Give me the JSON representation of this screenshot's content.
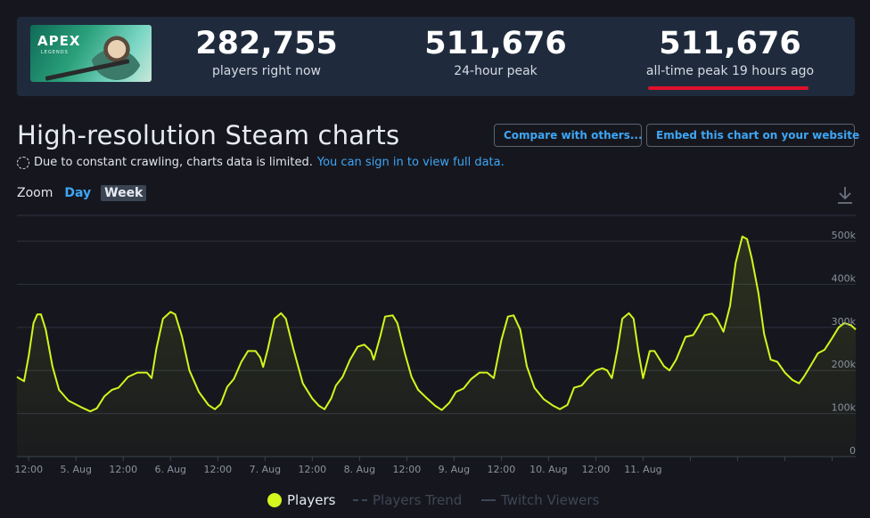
{
  "game": {
    "logo_text": "APEX",
    "logo_sub": "LEGENDS"
  },
  "stats": [
    {
      "value": "282,755",
      "label": "players right now"
    },
    {
      "value": "511,676",
      "label": "24-hour peak"
    },
    {
      "value": "511,676",
      "label": "all-time peak 19 hours ago"
    }
  ],
  "page_title": "High-resolution Steam charts",
  "notice": {
    "text": "Due to constant crawling, charts data is limited.",
    "link": "You can sign in to view full data."
  },
  "buttons": {
    "compare": "Compare with others...",
    "embed": "Embed this chart on your website"
  },
  "zoom": {
    "label": "Zoom",
    "day": "Day",
    "week": "Week"
  },
  "legend": {
    "players": "Players",
    "trend": "Players Trend",
    "twitch": "Twitch Viewers"
  },
  "colors": {
    "players_line": "#d4f51d",
    "accent": "#3ea6f5",
    "peak_marker": "#e0102a",
    "background": "#16171e"
  },
  "chart_data": {
    "type": "line",
    "series": [
      {
        "name": "Players",
        "points": [
          [
            -0.125,
            185
          ],
          [
            -0.05,
            175
          ],
          [
            0.0,
            235
          ],
          [
            0.05,
            310
          ],
          [
            0.09,
            330
          ],
          [
            0.13,
            330
          ],
          [
            0.18,
            295
          ],
          [
            0.25,
            210
          ],
          [
            0.32,
            155
          ],
          [
            0.42,
            130
          ],
          [
            0.55,
            115
          ],
          [
            0.65,
            105
          ],
          [
            0.72,
            112
          ],
          [
            0.8,
            140
          ],
          [
            0.88,
            155
          ],
          [
            0.95,
            160
          ],
          [
            1.05,
            185
          ],
          [
            1.15,
            195
          ],
          [
            1.25,
            195
          ],
          [
            1.3,
            182
          ],
          [
            1.35,
            250
          ],
          [
            1.42,
            320
          ],
          [
            1.5,
            336
          ],
          [
            1.55,
            330
          ],
          [
            1.62,
            280
          ],
          [
            1.7,
            200
          ],
          [
            1.8,
            150
          ],
          [
            1.9,
            120
          ],
          [
            1.97,
            110
          ],
          [
            2.03,
            122
          ],
          [
            2.1,
            162
          ],
          [
            2.17,
            180
          ],
          [
            2.25,
            220
          ],
          [
            2.32,
            245
          ],
          [
            2.4,
            245
          ],
          [
            2.45,
            230
          ],
          [
            2.48,
            208
          ],
          [
            2.53,
            250
          ],
          [
            2.6,
            320
          ],
          [
            2.67,
            333
          ],
          [
            2.72,
            320
          ],
          [
            2.8,
            250
          ],
          [
            2.9,
            170
          ],
          [
            3.0,
            135
          ],
          [
            3.07,
            118
          ],
          [
            3.13,
            110
          ],
          [
            3.2,
            135
          ],
          [
            3.25,
            165
          ],
          [
            3.32,
            185
          ],
          [
            3.4,
            225
          ],
          [
            3.48,
            255
          ],
          [
            3.55,
            260
          ],
          [
            3.62,
            245
          ],
          [
            3.65,
            225
          ],
          [
            3.72,
            280
          ],
          [
            3.77,
            325
          ],
          [
            3.85,
            328
          ],
          [
            3.9,
            310
          ],
          [
            3.98,
            240
          ],
          [
            4.05,
            185
          ],
          [
            4.12,
            155
          ],
          [
            4.2,
            138
          ],
          [
            4.3,
            118
          ],
          [
            4.37,
            108
          ],
          [
            4.45,
            125
          ],
          [
            4.52,
            150
          ],
          [
            4.6,
            158
          ],
          [
            4.68,
            180
          ],
          [
            4.77,
            195
          ],
          [
            4.85,
            195
          ],
          [
            4.92,
            182
          ],
          [
            5.0,
            270
          ],
          [
            5.07,
            325
          ],
          [
            5.13,
            328
          ],
          [
            5.2,
            295
          ],
          [
            5.27,
            210
          ],
          [
            5.35,
            160
          ],
          [
            5.45,
            133
          ],
          [
            5.55,
            118
          ],
          [
            5.62,
            110
          ],
          [
            5.7,
            120
          ],
          [
            5.77,
            160
          ],
          [
            5.85,
            165
          ],
          [
            5.92,
            183
          ],
          [
            6.0,
            200
          ],
          [
            6.07,
            205
          ],
          [
            6.12,
            200
          ],
          [
            6.17,
            182
          ],
          [
            6.23,
            250
          ],
          [
            6.28,
            320
          ],
          [
            6.35,
            333
          ],
          [
            6.4,
            320
          ],
          [
            6.45,
            245
          ],
          [
            6.5,
            182
          ],
          [
            6.57,
            245
          ],
          [
            6.62,
            245
          ],
          [
            6.72,
            210
          ],
          [
            6.78,
            200
          ],
          [
            6.85,
            225
          ],
          [
            6.95,
            278
          ],
          [
            7.03,
            282
          ],
          [
            7.08,
            300
          ],
          [
            7.15,
            328
          ],
          [
            7.23,
            332
          ],
          [
            7.28,
            320
          ],
          [
            7.35,
            290
          ],
          [
            7.42,
            350
          ],
          [
            7.48,
            450
          ],
          [
            7.55,
            511
          ],
          [
            7.6,
            505
          ],
          [
            7.65,
            460
          ],
          [
            7.72,
            380
          ],
          [
            7.78,
            285
          ],
          [
            7.85,
            225
          ],
          [
            7.92,
            220
          ],
          [
            8.0,
            195
          ],
          [
            8.08,
            178
          ],
          [
            8.15,
            170
          ],
          [
            8.2,
            185
          ],
          [
            8.27,
            210
          ],
          [
            8.35,
            240
          ],
          [
            8.42,
            248
          ],
          [
            8.5,
            275
          ],
          [
            8.57,
            300
          ],
          [
            8.63,
            310
          ],
          [
            8.7,
            305
          ],
          [
            8.75,
            295
          ]
        ]
      }
    ],
    "x_tick_labels": [
      "12:00",
      "5. Aug",
      "12:00",
      "6. Aug",
      "12:00",
      "7. Aug",
      "12:00",
      "8. Aug",
      "12:00",
      "9. Aug",
      "12:00",
      "10. Aug",
      "12:00",
      "11. Aug"
    ],
    "x_ticks": [
      0,
      0.5,
      1,
      1.5,
      2,
      2.5,
      3,
      3.5,
      4,
      4.5,
      5,
      5.5,
      6,
      6.5,
      7,
      7.5,
      8,
      8.5
    ],
    "y_ticks": [
      0,
      100,
      200,
      300,
      400,
      500
    ],
    "y_tick_labels": [
      "0",
      "100k",
      "200k",
      "300k",
      "400k",
      "500k"
    ],
    "xlim": [
      -0.125,
      8.75
    ],
    "ylim": [
      0,
      560
    ],
    "grid": true
  }
}
